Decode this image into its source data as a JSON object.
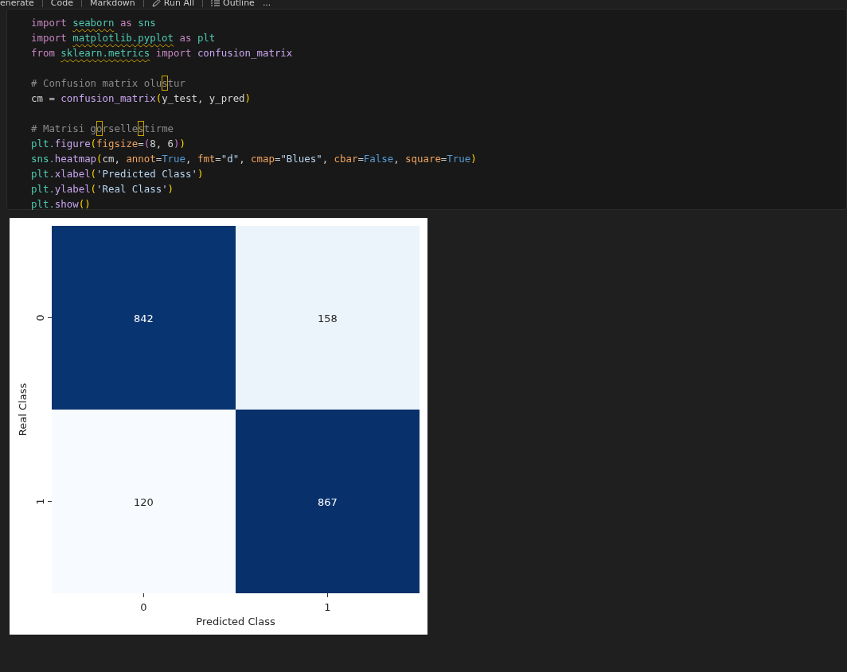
{
  "toolbar": [
    {
      "kind": "text",
      "label": "enerate"
    },
    {
      "kind": "text",
      "label": "Code"
    },
    {
      "kind": "text",
      "label": "Markdown"
    },
    {
      "kind": "run",
      "label": "Run All"
    },
    {
      "kind": "outline",
      "label": "Outline"
    },
    {
      "kind": "more",
      "label": "..."
    }
  ],
  "code_cell": {
    "lines": [
      {
        "tokens": [
          {
            "t": "import ",
            "kind": "kw"
          },
          {
            "t": "seaborn",
            "kind": "mod",
            "squiggle": true
          },
          {
            "t": " as ",
            "kind": "kw"
          },
          {
            "t": "sns",
            "kind": "mod"
          }
        ]
      },
      {
        "tokens": [
          {
            "t": "import ",
            "kind": "kw"
          },
          {
            "t": "matplotlib.pyplot",
            "kind": "mod",
            "squiggle": true
          },
          {
            "t": " as ",
            "kind": "kw"
          },
          {
            "t": "plt",
            "kind": "mod"
          }
        ]
      },
      {
        "tokens": [
          {
            "t": "from ",
            "kind": "kw"
          },
          {
            "t": "sklearn.metrics",
            "kind": "mod",
            "squiggle": true
          },
          {
            "t": " import ",
            "kind": "kw"
          },
          {
            "t": "confusion_matrix",
            "kind": "fn"
          }
        ]
      },
      {
        "gap_before": true,
        "tokens": [
          {
            "t": "# Confusion matrix olu",
            "kind": "comment"
          },
          {
            "t": "s",
            "kind": "comment",
            "flagged": true
          },
          {
            "t": "tur",
            "kind": "comment"
          }
        ]
      },
      {
        "tokens": [
          {
            "t": "cm = ",
            "kind": "plain"
          },
          {
            "t": "confusion_matrix",
            "kind": "fn"
          },
          {
            "t": "(",
            "kind": "paren"
          },
          {
            "t": "y_test, y_pred",
            "kind": "plain"
          },
          {
            "t": ")",
            "kind": "paren"
          }
        ]
      },
      {
        "gap_before": true,
        "tokens": [
          {
            "t": "# Matrisi g",
            "kind": "comment"
          },
          {
            "t": "o",
            "kind": "comment",
            "flagged": true
          },
          {
            "t": "rselle",
            "kind": "comment"
          },
          {
            "t": "s",
            "kind": "comment",
            "flagged": true
          },
          {
            "t": "tirme",
            "kind": "comment"
          }
        ]
      },
      {
        "tokens": [
          {
            "t": "plt.",
            "kind": "mod"
          },
          {
            "t": "figure",
            "kind": "fn"
          },
          {
            "t": "(",
            "kind": "paren"
          },
          {
            "t": "figsize",
            "kind": "param"
          },
          {
            "t": "=",
            "kind": "plain"
          },
          {
            "t": "(",
            "kind": "paren2"
          },
          {
            "t": "8, 6",
            "kind": "plain"
          },
          {
            "t": ")",
            "kind": "paren2"
          },
          {
            "t": ")",
            "kind": "paren"
          }
        ]
      },
      {
        "tokens": [
          {
            "t": "sns.",
            "kind": "mod"
          },
          {
            "t": "heatmap",
            "kind": "fn"
          },
          {
            "t": "(",
            "kind": "paren"
          },
          {
            "t": "cm, ",
            "kind": "plain"
          },
          {
            "t": "annot",
            "kind": "param"
          },
          {
            "t": "=",
            "kind": "plain"
          },
          {
            "t": "True",
            "kind": "bool"
          },
          {
            "t": ", ",
            "kind": "plain"
          },
          {
            "t": "fmt",
            "kind": "param"
          },
          {
            "t": "=",
            "kind": "plain"
          },
          {
            "t": "\"d\"",
            "kind": "str"
          },
          {
            "t": ", ",
            "kind": "plain"
          },
          {
            "t": "cmap",
            "kind": "param"
          },
          {
            "t": "=",
            "kind": "plain"
          },
          {
            "t": "\"Blues\"",
            "kind": "str"
          },
          {
            "t": ", ",
            "kind": "plain"
          },
          {
            "t": "cbar",
            "kind": "param"
          },
          {
            "t": "=",
            "kind": "plain"
          },
          {
            "t": "False",
            "kind": "bool"
          },
          {
            "t": ", ",
            "kind": "plain"
          },
          {
            "t": "square",
            "kind": "param"
          },
          {
            "t": "=",
            "kind": "plain"
          },
          {
            "t": "True",
            "kind": "bool"
          },
          {
            "t": ")",
            "kind": "paren"
          }
        ]
      },
      {
        "tokens": [
          {
            "t": "plt.",
            "kind": "mod"
          },
          {
            "t": "xlabel",
            "kind": "fn"
          },
          {
            "t": "(",
            "kind": "paren"
          },
          {
            "t": "'Predicted Class'",
            "kind": "str"
          },
          {
            "t": ")",
            "kind": "paren"
          }
        ]
      },
      {
        "tokens": [
          {
            "t": "plt.",
            "kind": "mod"
          },
          {
            "t": "ylabel",
            "kind": "fn"
          },
          {
            "t": "(",
            "kind": "paren"
          },
          {
            "t": "'Real Class'",
            "kind": "str"
          },
          {
            "t": ")",
            "kind": "paren"
          }
        ]
      },
      {
        "tokens": [
          {
            "t": "plt.",
            "kind": "mod"
          },
          {
            "t": "show",
            "kind": "fn"
          },
          {
            "t": "(",
            "kind": "paren"
          },
          {
            "t": ")",
            "kind": "paren"
          }
        ]
      }
    ]
  },
  "output": {
    "heatmap": {
      "xlabel": "Predicted Class",
      "ylabel": "Real Class",
      "xticks": [
        "0",
        "1"
      ],
      "yticks": [
        "0",
        "1"
      ],
      "cells": [
        [
          {
            "value": "842",
            "color": "#083471"
          },
          {
            "value": "158",
            "color": "#ebf3fb"
          }
        ],
        [
          {
            "value": "120",
            "color": "#f7fbff"
          },
          {
            "value": "867",
            "color": "#08306b"
          }
        ]
      ]
    }
  }
}
